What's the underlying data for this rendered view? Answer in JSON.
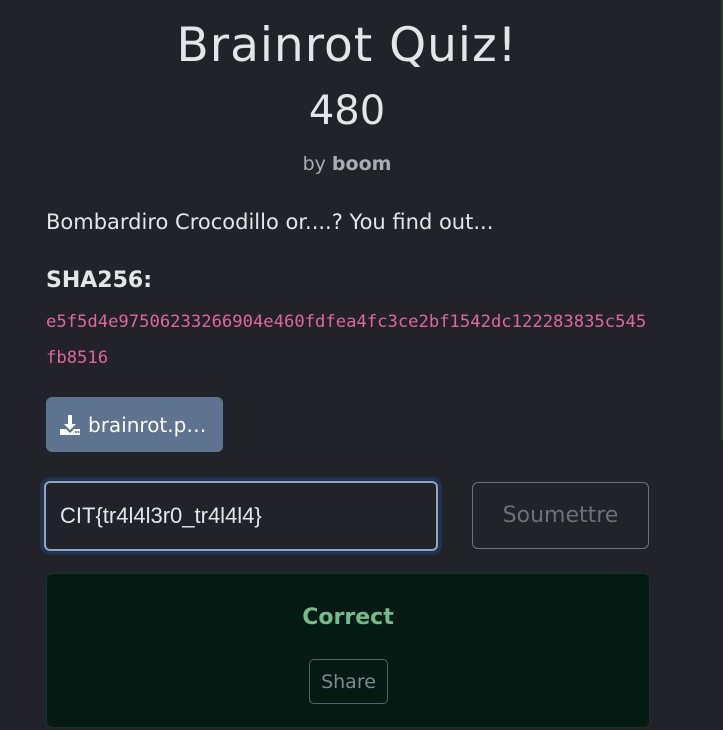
{
  "challenge": {
    "title": "Brainrot Quiz!",
    "points": "480",
    "author_prefix": "by",
    "author": "boom",
    "description": "Bombardiro Crocodillo or....? You find out...",
    "sha_label": "SHA256:",
    "sha_value": "e5f5d4e97506233266904e460fdfea4fc3ce2bf1542dc122283835c545fb8516"
  },
  "download": {
    "label": "brainrot.pcap",
    "icon": "download-icon"
  },
  "submission": {
    "input_value": "CIT{tr4l4l3r0_tr4l4l4}",
    "submit_label": "Soumettre"
  },
  "result": {
    "status": "Correct",
    "share_label": "Share"
  },
  "colors": {
    "background": "#212329",
    "hash": "#e0669c",
    "download_button": "#5d7390",
    "success_text": "#6fbf8e",
    "success_background": "#041a13"
  }
}
